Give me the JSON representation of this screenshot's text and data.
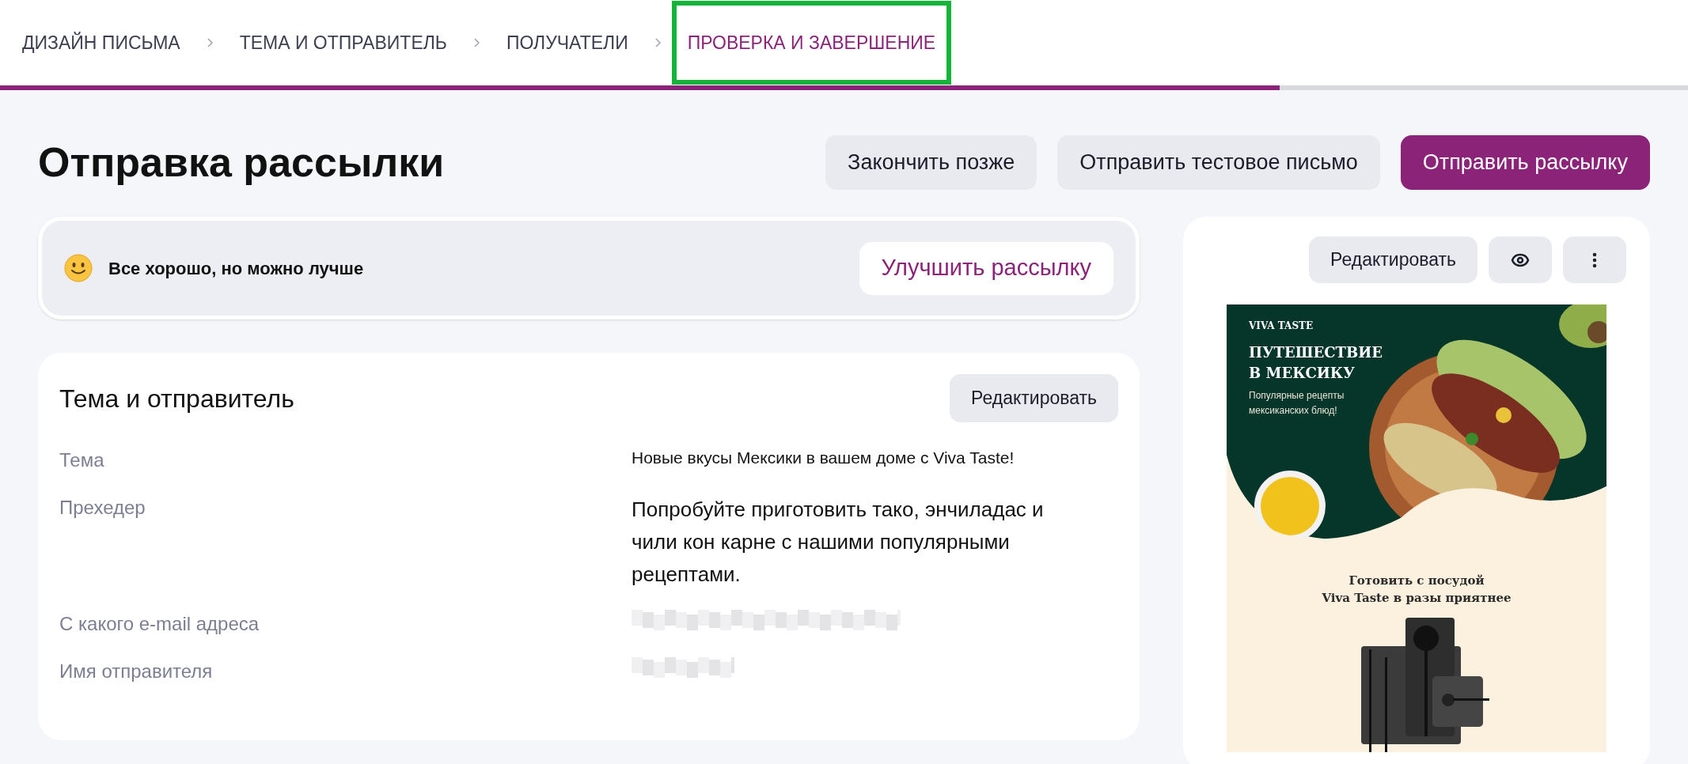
{
  "steps": [
    {
      "label": "ДИЗАЙН ПИСЬМА",
      "selected": false,
      "highlighted": false
    },
    {
      "label": "ТЕМА И ОТПРАВИТЕЛЬ",
      "selected": false,
      "highlighted": false
    },
    {
      "label": "ПОЛУЧАТЕЛИ",
      "selected": false,
      "highlighted": false
    },
    {
      "label": "ПРОВЕРКА И ЗАВЕРШЕНИЕ",
      "selected": true,
      "highlighted": true
    }
  ],
  "progress": {
    "level": 0.758
  },
  "page_title": "Отправка рассылки",
  "actions": [
    {
      "label": "Закончить позже",
      "kind": "secondary"
    },
    {
      "label": "Отправить тестовое письмо",
      "kind": "secondary"
    },
    {
      "label": "Отправить рассылку",
      "kind": "primary"
    }
  ],
  "check_banner": {
    "message": "Все хорошо, но можно лучше",
    "button": "Улучшить рассылку"
  },
  "details_card": {
    "title": "Тема и отправитель",
    "edit_button": "Редактировать",
    "rows": [
      {
        "label": "Тема",
        "value": "Новые вкусы Мексики в вашем доме с Viva Taste!"
      },
      {
        "label": "Прехедер",
        "value": "Попробуйте приготовить тако, энчиладас и чили кон карне с нашими популярными рецептами."
      },
      {
        "label": "С какого e-mail адреса",
        "redacted": true
      },
      {
        "label": "Имя отправителя",
        "redacted": true
      }
    ]
  },
  "preview": {
    "edit_button": "Редактировать",
    "email": {
      "brand": "VIVA TASTE",
      "headline": [
        "ПУТЕШЕСТВИЕ",
        "В МЕКСИКУ"
      ],
      "subtitle": [
        "Популярные рецепты",
        "мексиканских блюд!"
      ],
      "section_heading": [
        "Готовить с посудой",
        "Viva Taste в разы приятнее"
      ]
    }
  }
}
